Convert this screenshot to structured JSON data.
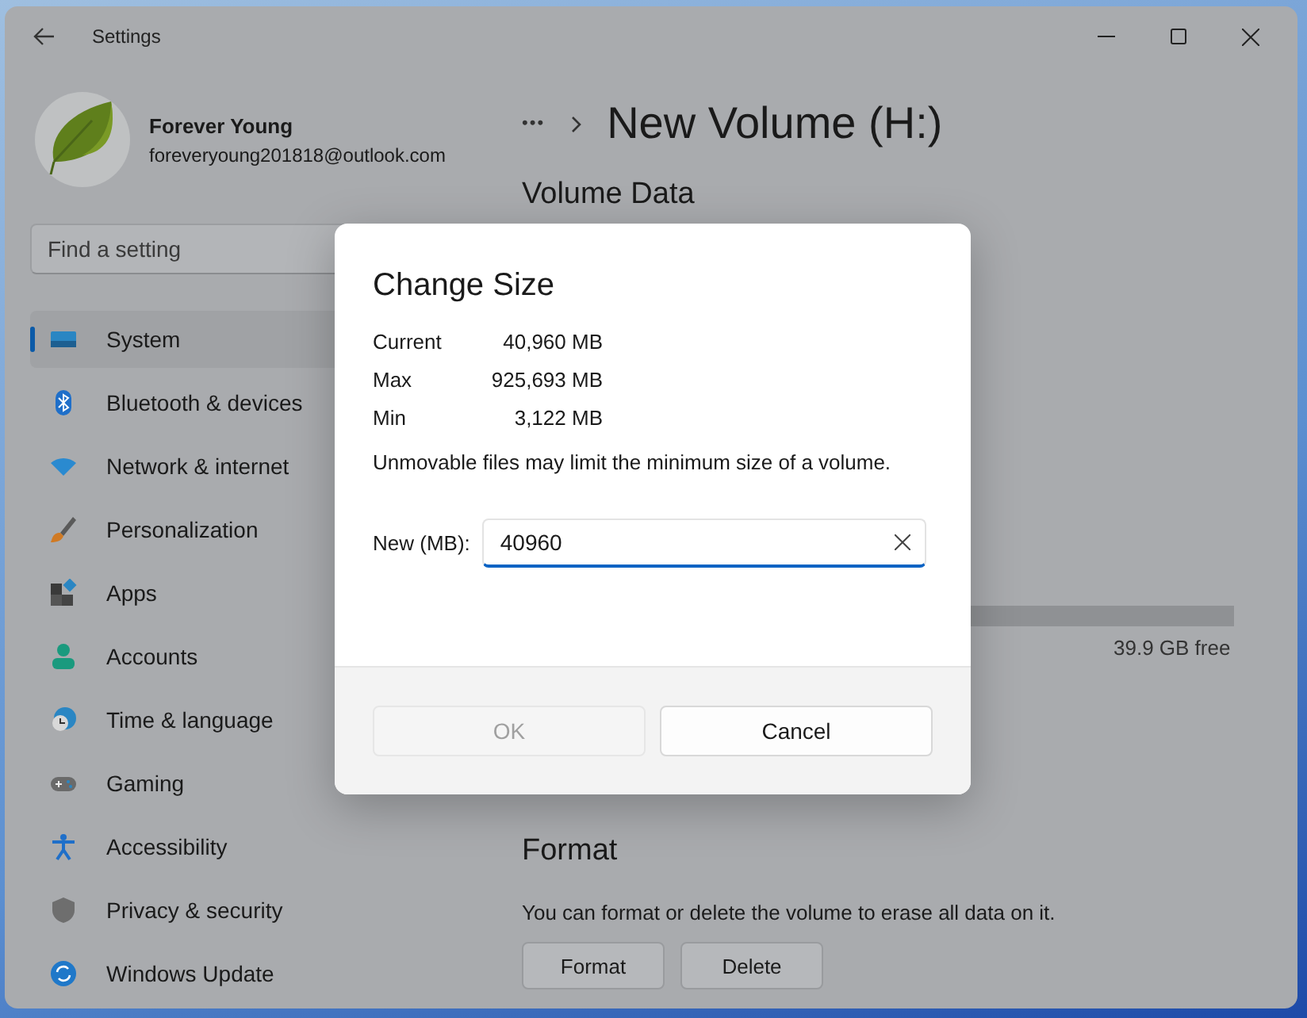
{
  "window": {
    "title": "Settings"
  },
  "account": {
    "name": "Forever Young",
    "email": "foreveryoung201818@outlook.com"
  },
  "search": {
    "placeholder": "Find a setting"
  },
  "nav": [
    {
      "label": "System",
      "selected": true
    },
    {
      "label": "Bluetooth & devices",
      "selected": false
    },
    {
      "label": "Network & internet",
      "selected": false
    },
    {
      "label": "Personalization",
      "selected": false
    },
    {
      "label": "Apps",
      "selected": false
    },
    {
      "label": "Accounts",
      "selected": false
    },
    {
      "label": "Time & language",
      "selected": false
    },
    {
      "label": "Gaming",
      "selected": false
    },
    {
      "label": "Accessibility",
      "selected": false
    },
    {
      "label": "Privacy & security",
      "selected": false
    },
    {
      "label": "Windows Update",
      "selected": false
    }
  ],
  "breadcrumb": {
    "overflow": "•••",
    "title": "New Volume (H:)"
  },
  "volume_data": {
    "heading": "Volume Data",
    "free": "39.9 GB free"
  },
  "format": {
    "heading": "Format",
    "description": "You can format or delete the volume to erase all data on it.",
    "buttons": [
      "Format",
      "Delete"
    ]
  },
  "dialog": {
    "title": "Change Size",
    "stats": [
      {
        "label": "Current",
        "value": "40,960 MB"
      },
      {
        "label": "Max",
        "value": "925,693 MB"
      },
      {
        "label": "Min",
        "value": "3,122 MB"
      }
    ],
    "note": "Unmovable files may limit the minimum size of a volume.",
    "field": {
      "label": "New (MB):",
      "value": "40960"
    },
    "buttons": [
      {
        "label": "OK",
        "disabled": true
      },
      {
        "label": "Cancel",
        "disabled": false
      }
    ]
  }
}
